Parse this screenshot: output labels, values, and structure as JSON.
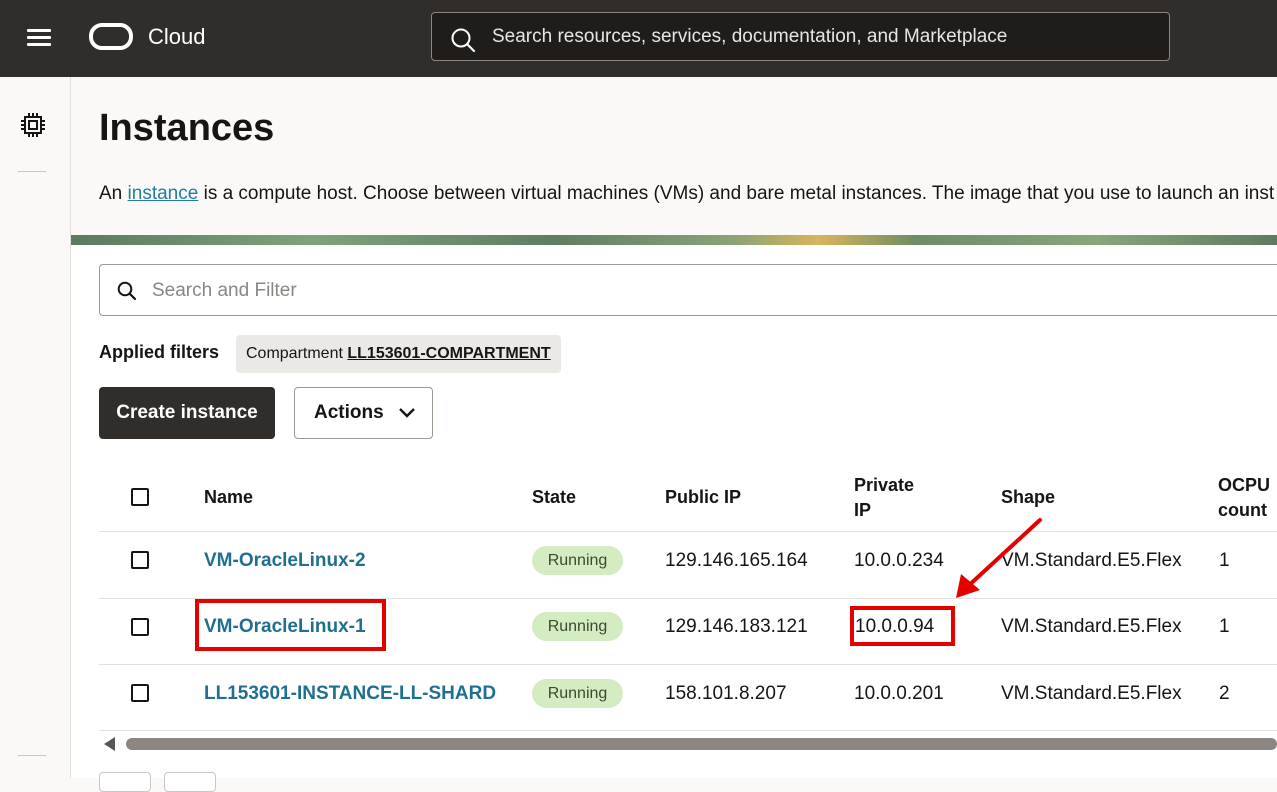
{
  "topbar": {
    "brand": "Cloud",
    "search_placeholder": "Search resources, services, documentation, and Marketplace"
  },
  "page": {
    "title": "Instances",
    "desc_prefix": "An ",
    "desc_link": "instance",
    "desc_suffix": " is a compute host. Choose between virtual machines (VMs) and bare metal instances. The image that you use to launch an inst"
  },
  "filter": {
    "placeholder": "Search and Filter",
    "applied_label": "Applied filters",
    "chip_key": "Compartment",
    "chip_value": "LL153601-COMPARTMENT"
  },
  "toolbar": {
    "create_label": "Create instance",
    "actions_label": "Actions"
  },
  "table": {
    "headers": {
      "name": "Name",
      "state": "State",
      "public_ip": "Public IP",
      "private_ip_1": "Private",
      "private_ip_2": "IP",
      "shape": "Shape",
      "ocpu_1": "OCPU",
      "ocpu_2": "count"
    },
    "rows": [
      {
        "name": "VM-OracleLinux-2",
        "state": "Running",
        "public_ip": "129.146.165.164",
        "private_ip": "10.0.0.234",
        "shape": "VM.Standard.E5.Flex",
        "ocpu": "1"
      },
      {
        "name": "VM-OracleLinux-1",
        "state": "Running",
        "public_ip": "129.146.183.121",
        "private_ip": "10.0.0.94",
        "shape": "VM.Standard.E5.Flex",
        "ocpu": "1"
      },
      {
        "name": "LL153601-INSTANCE-LL-SHARD",
        "state": "Running",
        "public_ip": "158.101.8.207",
        "private_ip": "10.0.0.201",
        "shape": "VM.Standard.E5.Flex",
        "ocpu": "2"
      }
    ]
  },
  "colors": {
    "topbar": "#312d2a",
    "link": "#1f6f8f",
    "running_badge": "#d3ecc2",
    "annotation": "#e50000"
  }
}
